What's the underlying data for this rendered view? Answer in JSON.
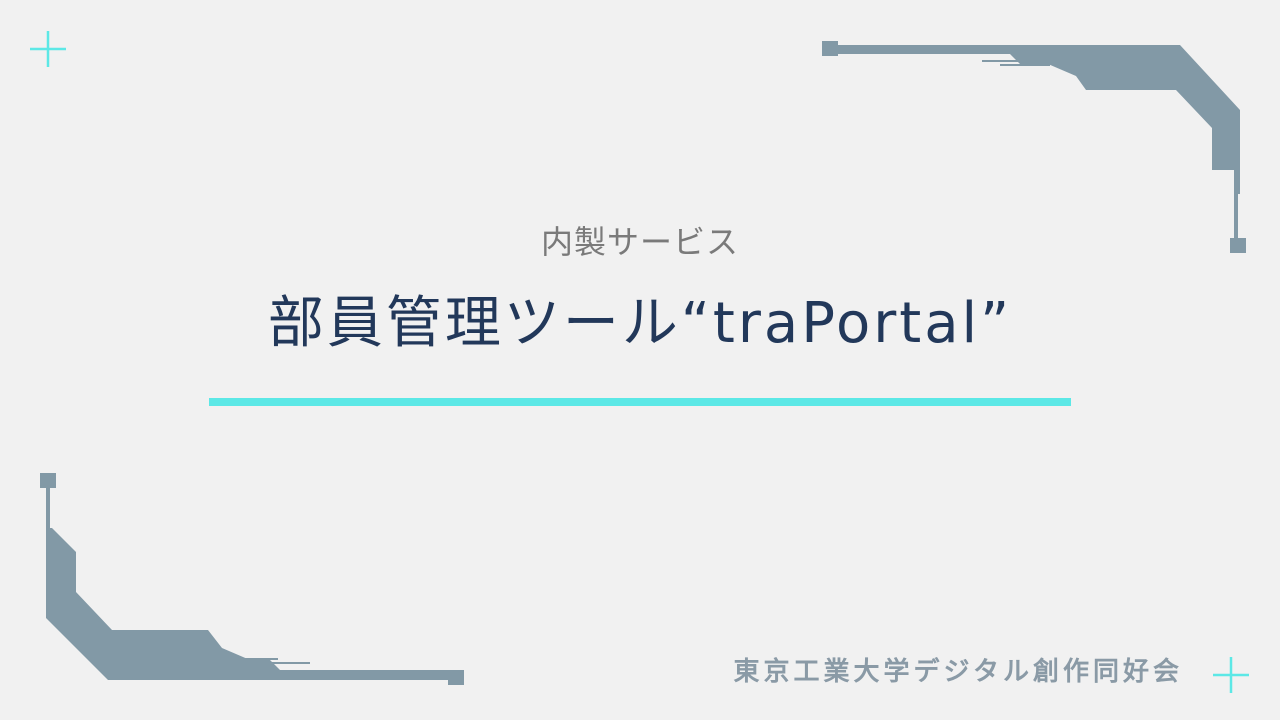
{
  "slide": {
    "subtitle": "内製サービス",
    "title": "部員管理ツール“traPortal”",
    "organization": "東京工業大学デジタル創作同好会"
  },
  "decorations": {
    "corner_icons": [
      "plus-icon",
      "plus-icon"
    ],
    "frame": "circuit-frame"
  },
  "colors": {
    "background": "#f1f1f1",
    "accent": "#5ce8e6",
    "frame": "#8299a6",
    "title": "#22385a",
    "subtitle": "#7a7a7a",
    "organization": "#8a9aa6"
  }
}
